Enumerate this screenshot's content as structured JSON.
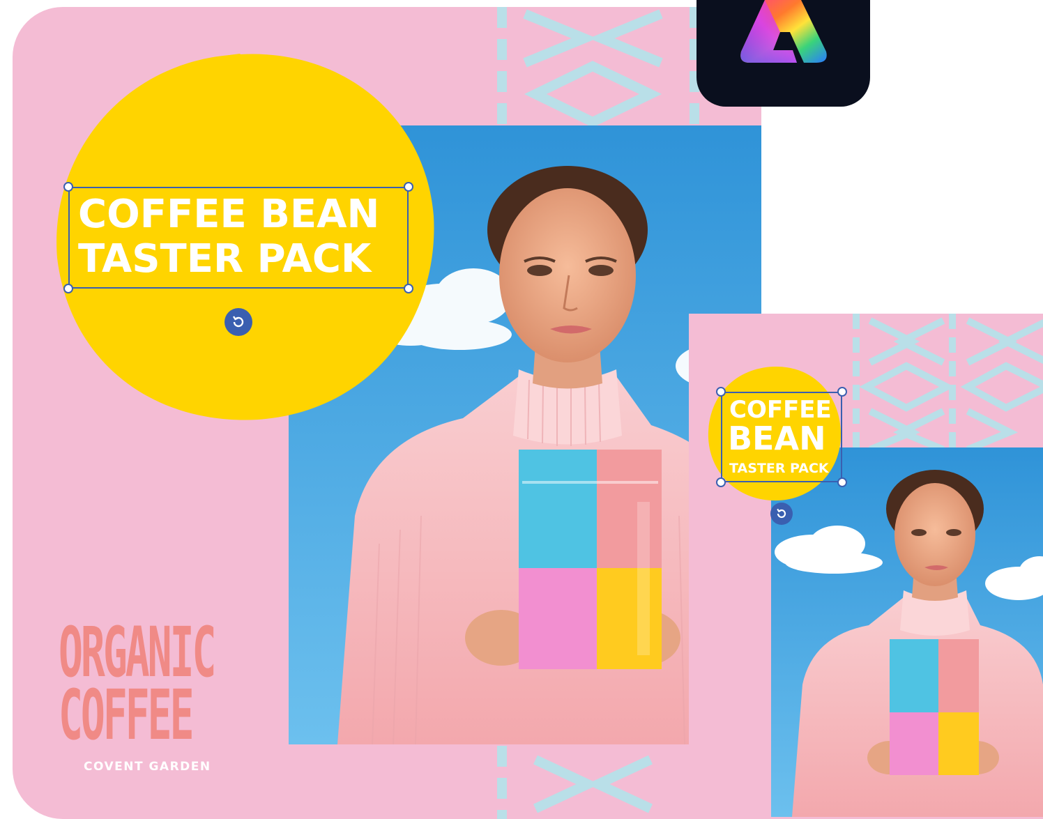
{
  "brand": {
    "logo_icon": "adobe-express-logo-icon"
  },
  "colors": {
    "card_pink": "#f4bcd4",
    "pattern_blue": "#b9dfe8",
    "badge_yellow": "#ffd400",
    "selection_blue": "#3a5fb0",
    "sky_blue": "#3a9fdc",
    "coral": "#f08a86"
  },
  "design_large": {
    "headline_line1": "COFFEE BEAN",
    "headline_line2": "TASTER PACK",
    "organic_line1": "ORGANIC",
    "organic_line2": "COFFEE",
    "location": "COVENT GARDEN",
    "rotate_icon": "rotate-icon"
  },
  "design_small": {
    "headline_line1": "COFFEE",
    "headline_line2": "BEAN",
    "headline_line3": "TASTER PACK",
    "rotate_icon": "rotate-icon"
  }
}
